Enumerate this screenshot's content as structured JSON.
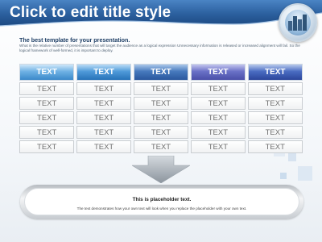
{
  "slide": {
    "title": "Click to edit title style",
    "subtitle": "The best template for your presentation.",
    "description": "What is the relative number of presentations that will target the audience as a logical expression Unnecessary information is released or increased alignment will fail. So the logical framework of well-formed, it is important to deploy.",
    "logo_icon": "city-buildings-icon"
  },
  "table": {
    "headers": [
      "TEXT",
      "TEXT",
      "TEXT",
      "TEXT",
      "TEXT"
    ],
    "rows": [
      [
        "TEXT",
        "TEXT",
        "TEXT",
        "TEXT",
        "TEXT"
      ],
      [
        "TEXT",
        "TEXT",
        "TEXT",
        "TEXT",
        "TEXT"
      ],
      [
        "TEXT",
        "TEXT",
        "TEXT",
        "TEXT",
        "TEXT"
      ],
      [
        "TEXT",
        "TEXT",
        "TEXT",
        "TEXT",
        "TEXT"
      ],
      [
        "TEXT",
        "TEXT",
        "TEXT",
        "TEXT",
        "TEXT"
      ]
    ],
    "header_colors": [
      "#3b88c9",
      "#2672b8",
      "#2a579d",
      "#4a4fa8",
      "#2b459a"
    ]
  },
  "placeholder": {
    "title": "This is placeholder text.",
    "text": "The text demonstrates how your own text will look when you replace the placeholder with your own text."
  },
  "colors": {
    "banner": "#2b5f9e",
    "arrow": "#9aa3ab"
  }
}
